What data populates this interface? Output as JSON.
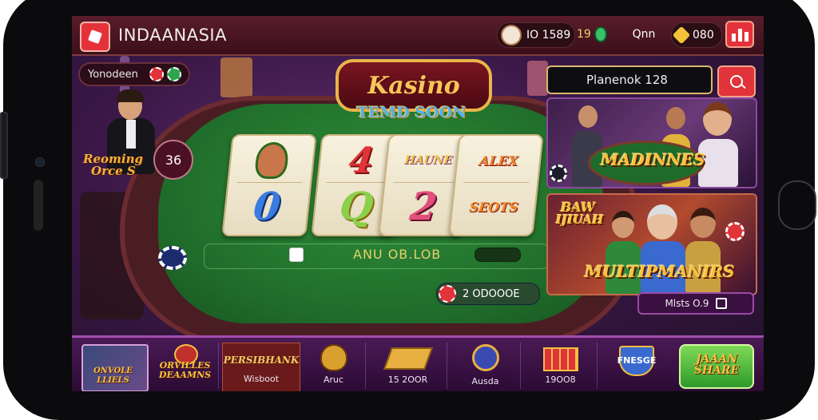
{
  "app": {
    "title": "INDAANASIA"
  },
  "topbar": {
    "balance1": "IO 1589",
    "balance2": "19",
    "user": "Qnn",
    "coins": "080"
  },
  "left": {
    "yonb_label": "Yonodeen",
    "badge_value": "36",
    "promo": [
      "Reoming",
      "Orce S"
    ]
  },
  "table": {
    "brand": "Kasino",
    "subtitle": "TEMD SOON",
    "cards": [
      {
        "top": "",
        "bottom": "0"
      },
      {
        "top": "4",
        "bottom": "Q"
      },
      {
        "top": "HAUNE",
        "bottom": "2"
      },
      {
        "top": "ALEX",
        "bottom": "SEOTS"
      }
    ],
    "info": "ANU  OB.LOB",
    "bet_label": "2  ODOOOE"
  },
  "right": {
    "search_value": "Planenok 128",
    "panel1_title": "MADINNES",
    "panel2_top": [
      "BAW",
      "IJIUAH"
    ],
    "panel2_title": "MULTIPMANIRS",
    "panel2_meta": "Mlsts O.9"
  },
  "bottombar": {
    "items": [
      {
        "label": "ONVOLE",
        "sub": "LLIELS",
        "type": "image"
      },
      {
        "label": "ORVILLES",
        "sub": "DEAAMNS",
        "type": "logo"
      },
      {
        "label": "PERSIBHANK",
        "sub": "Wisboot",
        "type": "highlight"
      },
      {
        "label": "",
        "sub": "Aruc",
        "type": "bag"
      },
      {
        "label": "",
        "sub": "15 2OOR",
        "type": "ticket"
      },
      {
        "label": "",
        "sub": "Ausda",
        "type": "coin"
      },
      {
        "label": "",
        "sub": "19OO8",
        "type": "cards"
      },
      {
        "label": "",
        "sub": "FNESGE",
        "type": "shield"
      },
      {
        "label": "JAAAN",
        "sub": "SHARE",
        "type": "button"
      }
    ]
  },
  "colors": {
    "accent": "#e5323a",
    "felt": "#1f6b2a",
    "gold": "#f5c040",
    "purple": "#4a1a55"
  }
}
